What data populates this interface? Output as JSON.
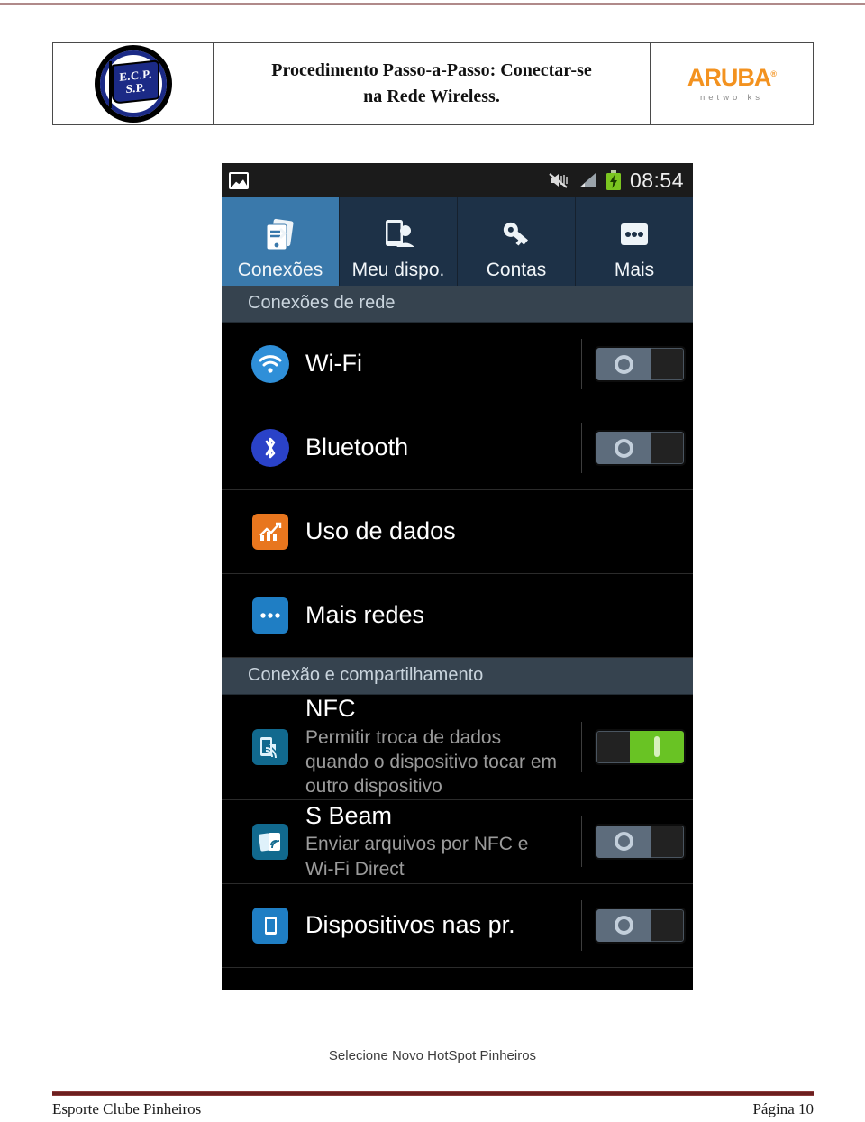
{
  "document": {
    "header": {
      "logo_alt": "Esporte Clube Pinheiros",
      "emblem_line1": "E.C.P.",
      "emblem_line2": "S.P.",
      "title_line1": "Procedimento Passo-a-Passo: Conectar-se",
      "title_line2": "na Rede Wireless.",
      "brand_word": "ARUBA",
      "brand_mark": "®",
      "brand_sub": "networks"
    },
    "caption": "Selecione Novo HotSpot Pinheiros",
    "footer": {
      "left": "Esporte Clube Pinheiros",
      "right": "Página 10"
    }
  },
  "screenshot": {
    "statusbar": {
      "left_icon": "screenshot-icon",
      "mute_icon": "mute-icon",
      "signal_icon": "signal-bars-icon",
      "battery_icon": "battery-charging-icon",
      "time": "08:54"
    },
    "tabs": [
      {
        "label": "Conexões",
        "icon": "connections-icon",
        "active": true
      },
      {
        "label": "Meu dispo.",
        "icon": "my-device-icon",
        "active": false
      },
      {
        "label": "Contas",
        "icon": "accounts-icon",
        "active": false
      },
      {
        "label": "Mais",
        "icon": "more-dots-icon",
        "active": false
      }
    ],
    "sections": [
      {
        "heading": "Conexões de rede",
        "rows": [
          {
            "title": "Wi-Fi",
            "sub": "",
            "icon": "wifi-icon",
            "icon_color": "#2f8fd8",
            "toggle": "off"
          },
          {
            "title": "Bluetooth",
            "sub": "",
            "icon": "bluetooth-icon",
            "icon_color": "#2a42c8",
            "toggle": "off"
          },
          {
            "title": "Uso de dados",
            "sub": "",
            "icon": "data-usage-icon",
            "icon_color": "#e8761e",
            "toggle": "none"
          },
          {
            "title": "Mais redes",
            "sub": "",
            "icon": "more-networks-icon",
            "icon_color": "#1f7ec4",
            "toggle": "none"
          }
        ]
      },
      {
        "heading": "Conexão e compartilhamento",
        "rows": [
          {
            "title": "NFC",
            "sub": "Permitir troca de dados quando o dispositivo tocar em outro dispositivo",
            "icon": "nfc-icon",
            "icon_color": "#11698e",
            "toggle": "on"
          },
          {
            "title": "S Beam",
            "sub": "Enviar arquivos por NFC e Wi-Fi Direct",
            "icon": "sbeam-icon",
            "icon_color": "#11698e",
            "toggle": "off"
          },
          {
            "title": "Dispositivos nas pr.",
            "sub": "",
            "icon": "nearby-devices-icon",
            "icon_color": "#1f7ec4",
            "toggle": "off"
          }
        ]
      }
    ],
    "colors": {
      "tab_active": "#3a79ab",
      "tab_inactive": "#1d3147",
      "section_head": "#36434f",
      "toggle_on": "#69c324",
      "toggle_off": "#5d6c7c",
      "background": "#000000"
    }
  }
}
